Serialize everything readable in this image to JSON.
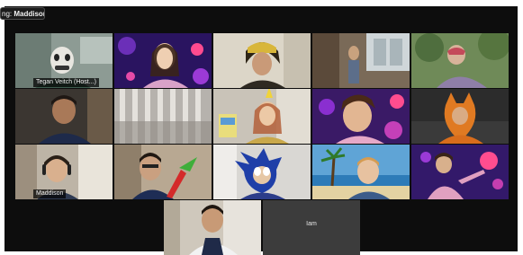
{
  "speaking_indicator": {
    "prefix": "ng:",
    "name": "Maddison"
  },
  "participants": [
    {
      "label": "Tegan Veitch (Host...)"
    },
    {
      "label": "Maddison"
    },
    {
      "label": "Iam"
    }
  ],
  "colors": {
    "active_outline": "#2f8fe0",
    "window_background": "#0d0d0d"
  }
}
